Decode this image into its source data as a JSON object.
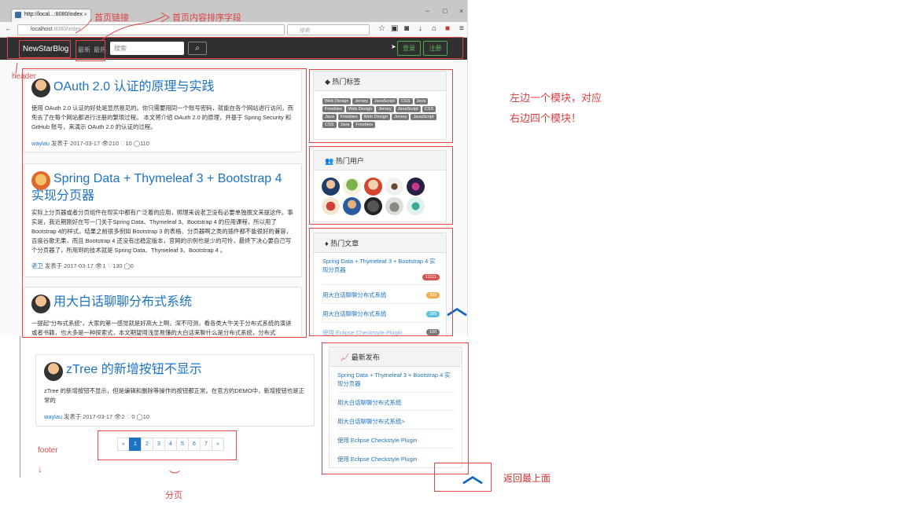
{
  "browser": {
    "tab_title": "http://local...:8080/index",
    "tab_close": "×",
    "window_controls": [
      "−",
      "□",
      "×"
    ],
    "url_host": "localhost",
    "url_path": ":8080/index",
    "search_placeholder": "搜索",
    "reload_icon": "C",
    "toolbar_icons": [
      "star-icon",
      "clipboard-icon",
      "pocket-icon",
      "download-icon",
      "home-icon",
      "extension-icon",
      "menu-icon"
    ]
  },
  "header": {
    "brand": "NewStarBlog",
    "nav": [
      "最新",
      "最热"
    ],
    "search_placeholder": "搜索",
    "search_icon": "🔍",
    "login": "登录",
    "register": "注册"
  },
  "posts": [
    {
      "title": "OAuth 2.0 认证的原理与实践",
      "body": "使用 OAuth 2.0 认证的好处是显然易见的。你只需要用同一个账号密码，就能在各个网站进行访问，而免去了在每个网站都进行注册的繁琐过程。 本文将介绍 OAuth 2.0 的原理，并基于 Spring Security 和 GitHub 账号，来演示 OAuth 2.0 的认证的过程。",
      "author": "waylau",
      "meta": "发表于 2017-03-17 👁210 ♡10 ◯110"
    },
    {
      "title": "Spring Data + Thymeleaf 3 + Bootstrap 4 实现分页器",
      "body": "实际上分页器或者分页组件在现实中都有广泛着的应用，照理来说老卫没有必要单独撰文来提这件。事实是，我近期刚好在写一门关于Spring Data、Thymeleaf 3、Bootstrap 4 的应用课程，所以用了Bootstrap 4的样式，结果之前很多例如 Bootstrap 3 的表格、分页器啊之类的插件都不能很好的兼容，百度谷歌无果，而且 Bootstrap 4 还没有出稳定版本，官网的示例也是少的可怜，最终下决心要自己写个分页器了，所用到的技术就是 Spring Data、Thymeleaf 3、Bootstrap 4 。",
      "author": "老卫",
      "meta": "发表于 2017-03-17 👁1 ♡130 ◯0"
    },
    {
      "title": "用大白话聊聊分布式系统",
      "body": "一提起\"分布式系统\"，大家的第一感觉就是好高大上啊，深不可测，看各类大牛关于分布式系统的演讲或者书籍，也大多是一种探索式，本文期望用浅显易懂的大白话来聊什么是分布式系统，分布式",
      "author": "",
      "meta": ""
    },
    {
      "title": "zTree 的新增按钮不显示",
      "body": "zTree 的新增按钮不显示，但是编辑和删除等操作的按钮都正常。在官方的DEMO中，新增按钮也是正常的",
      "author": "waylau",
      "meta": "发表于 2017-03-17 👁2 ♡0 ◯10"
    }
  ],
  "sidebar": {
    "hot_tags_title": "热门标签",
    "tags": [
      "Web Design",
      "Jersey",
      "JavaScript",
      "CSS",
      "Java",
      "Freebies",
      "Web Design",
      "Jersey",
      "JavaScript",
      "CSS",
      "Java",
      "Freebies",
      "Web Design",
      "Jersey",
      "JavaScript",
      "CSS",
      "Java",
      "Freebies"
    ],
    "hot_users_title": "热门用户",
    "hot_articles_title": "热门文章",
    "hot_articles": [
      {
        "title": "Spring Data + Thymeleaf 3 + Bootstrap 4 实现分页器",
        "count": "11111",
        "color": "#d9534f"
      },
      {
        "title": "用大白话聊聊分布式系统",
        "count": "339",
        "color": "#f0ad4e"
      },
      {
        "title": "用大白话聊聊分布式系统",
        "count": "289",
        "color": "#5bc0de"
      },
      {
        "title": "使用 Eclipse Checkstyle Plugin",
        "count": "100",
        "color": "#777777"
      }
    ],
    "latest_title": "最新发布",
    "latest": [
      "Spring Data + Thymeleaf 3 + Bootstrap 4 实现分页器",
      "用大白话聊聊分布式系统",
      "用大白话聊聊分布式系统>",
      "使用 Eclipse Checkstyle Plugin",
      "使用 Eclipse Checkstyle Plugin"
    ]
  },
  "pagination": {
    "prev": "«",
    "pages": [
      "1",
      "2",
      "3",
      "4",
      "5",
      "6",
      "7"
    ],
    "active": "1",
    "next": "»"
  },
  "annotations": {
    "home_link": "首页链接",
    "sort_field": "首页内容排序字段",
    "header": "header",
    "modules_line1": "左边一个模块，对应",
    "modules_line2": "右边四个模块！",
    "footer": "footer",
    "paging": "分页",
    "back_to_top": "返回最上面"
  },
  "back_to_top_icon": "︿",
  "colors": {
    "accent": "#1e72c2",
    "annotation": "#e04848",
    "header_bg": "#2f2f2f",
    "green": "#5cb85c"
  }
}
